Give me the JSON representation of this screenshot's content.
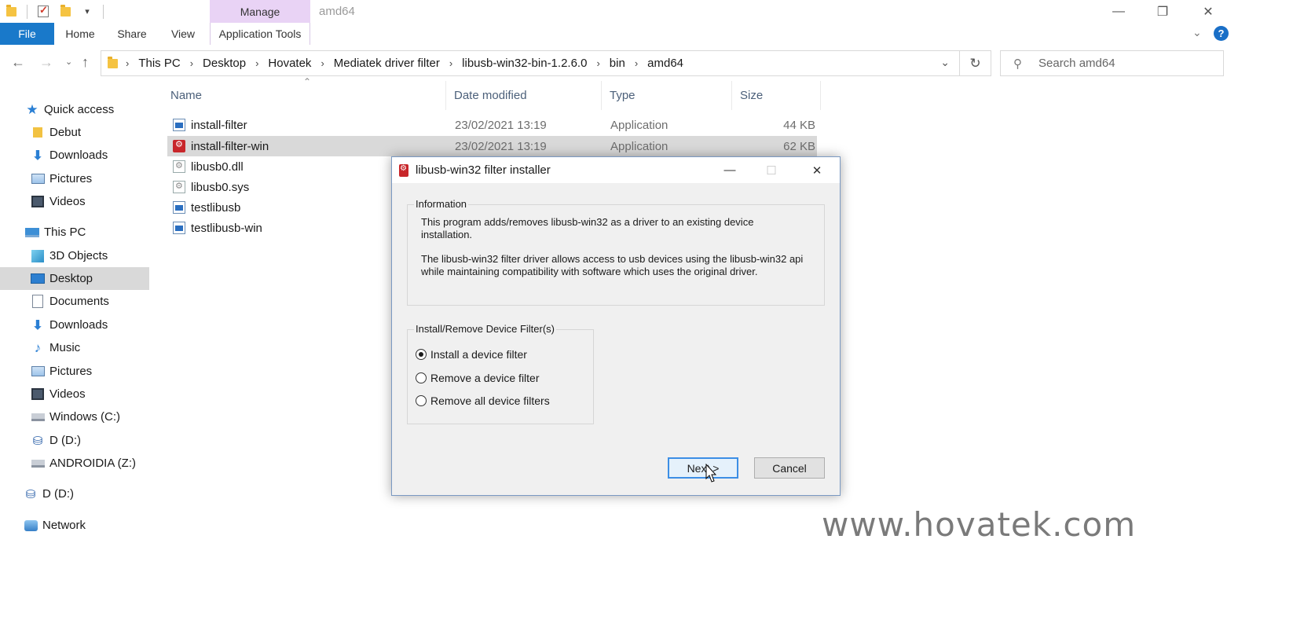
{
  "window": {
    "title": "amd64",
    "context_tab": "Manage",
    "controls": {
      "minimize": "—",
      "maximize": "❐",
      "close": "✕"
    }
  },
  "ribbon": {
    "tabs": [
      "File",
      "Home",
      "Share",
      "View",
      "Application Tools"
    ],
    "help": "?"
  },
  "address": {
    "path": [
      "This PC",
      "Desktop",
      "Hovatek",
      "Mediatek driver filter",
      "libusb-win32-bin-1.2.6.0",
      "bin",
      "amd64"
    ]
  },
  "search": {
    "placeholder": "Search amd64"
  },
  "nav": {
    "items": [
      {
        "label": "Quick access",
        "icon": "star-icon"
      },
      {
        "label": "Debut",
        "icon": "folder-icon"
      },
      {
        "label": "Downloads",
        "icon": "download-icon"
      },
      {
        "label": "Pictures",
        "icon": "pictures-icon"
      },
      {
        "label": "Videos",
        "icon": "videos-icon"
      },
      {
        "label": "This PC",
        "icon": "pc-icon"
      },
      {
        "label": "3D Objects",
        "icon": "3d-objects-icon"
      },
      {
        "label": "Desktop",
        "icon": "desktop-icon"
      },
      {
        "label": "Documents",
        "icon": "documents-icon"
      },
      {
        "label": "Downloads",
        "icon": "download-icon"
      },
      {
        "label": "Music",
        "icon": "music-icon"
      },
      {
        "label": "Pictures",
        "icon": "pictures-icon"
      },
      {
        "label": "Videos",
        "icon": "videos-icon"
      },
      {
        "label": "Windows (C:)",
        "icon": "drive-icon"
      },
      {
        "label": "D (D:)",
        "icon": "usb-drive-icon"
      },
      {
        "label": "ANDROIDIA (Z:)",
        "icon": "network-drive-icon"
      },
      {
        "label": "D (D:)",
        "icon": "usb-drive-icon"
      },
      {
        "label": "Network",
        "icon": "network-icon"
      }
    ],
    "selected_index": 7
  },
  "files": {
    "columns": [
      "Name",
      "Date modified",
      "Type",
      "Size"
    ],
    "rows": [
      {
        "name": "install-filter",
        "date": "23/02/2021 13:19",
        "type": "Application",
        "size": "44 KB",
        "icon": "application-icon"
      },
      {
        "name": "install-filter-win",
        "date": "23/02/2021 13:19",
        "type": "Application",
        "size": "62 KB",
        "icon": "libusb-app-icon"
      },
      {
        "name": "libusb0.dll",
        "date": "",
        "type": "",
        "size": "",
        "icon": "dll-icon"
      },
      {
        "name": "libusb0.sys",
        "date": "",
        "type": "",
        "size": "",
        "icon": "sys-icon"
      },
      {
        "name": "testlibusb",
        "date": "",
        "type": "",
        "size": "",
        "icon": "application-icon"
      },
      {
        "name": "testlibusb-win",
        "date": "",
        "type": "",
        "size": "",
        "icon": "application-icon"
      }
    ],
    "selected_index": 1
  },
  "dialog": {
    "title": "libusb-win32 filter installer",
    "info_legend": "Information",
    "info_p1_line1": "This program adds/removes libusb-win32 as a driver to an existing device",
    "info_p1_line2": "installation.",
    "info_p2_line1": "The libusb-win32 filter driver allows access to usb devices using the libusb-win32 api",
    "info_p2_line2": "while maintaining compatibility with software which uses the original driver.",
    "options_legend": "Install/Remove Device Filter(s)",
    "options": [
      "Install a device filter",
      "Remove a device filter",
      "Remove all device filters"
    ],
    "selected_option": 0,
    "next_label": "Next >",
    "cancel_label": "Cancel"
  },
  "watermark": "www.hovatek.com",
  "colors": {
    "accent": "#1979ca",
    "manage_tab": "#e9d3f5",
    "selection": "#d9d9d9",
    "dialog_bg": "#f0f0f0"
  }
}
